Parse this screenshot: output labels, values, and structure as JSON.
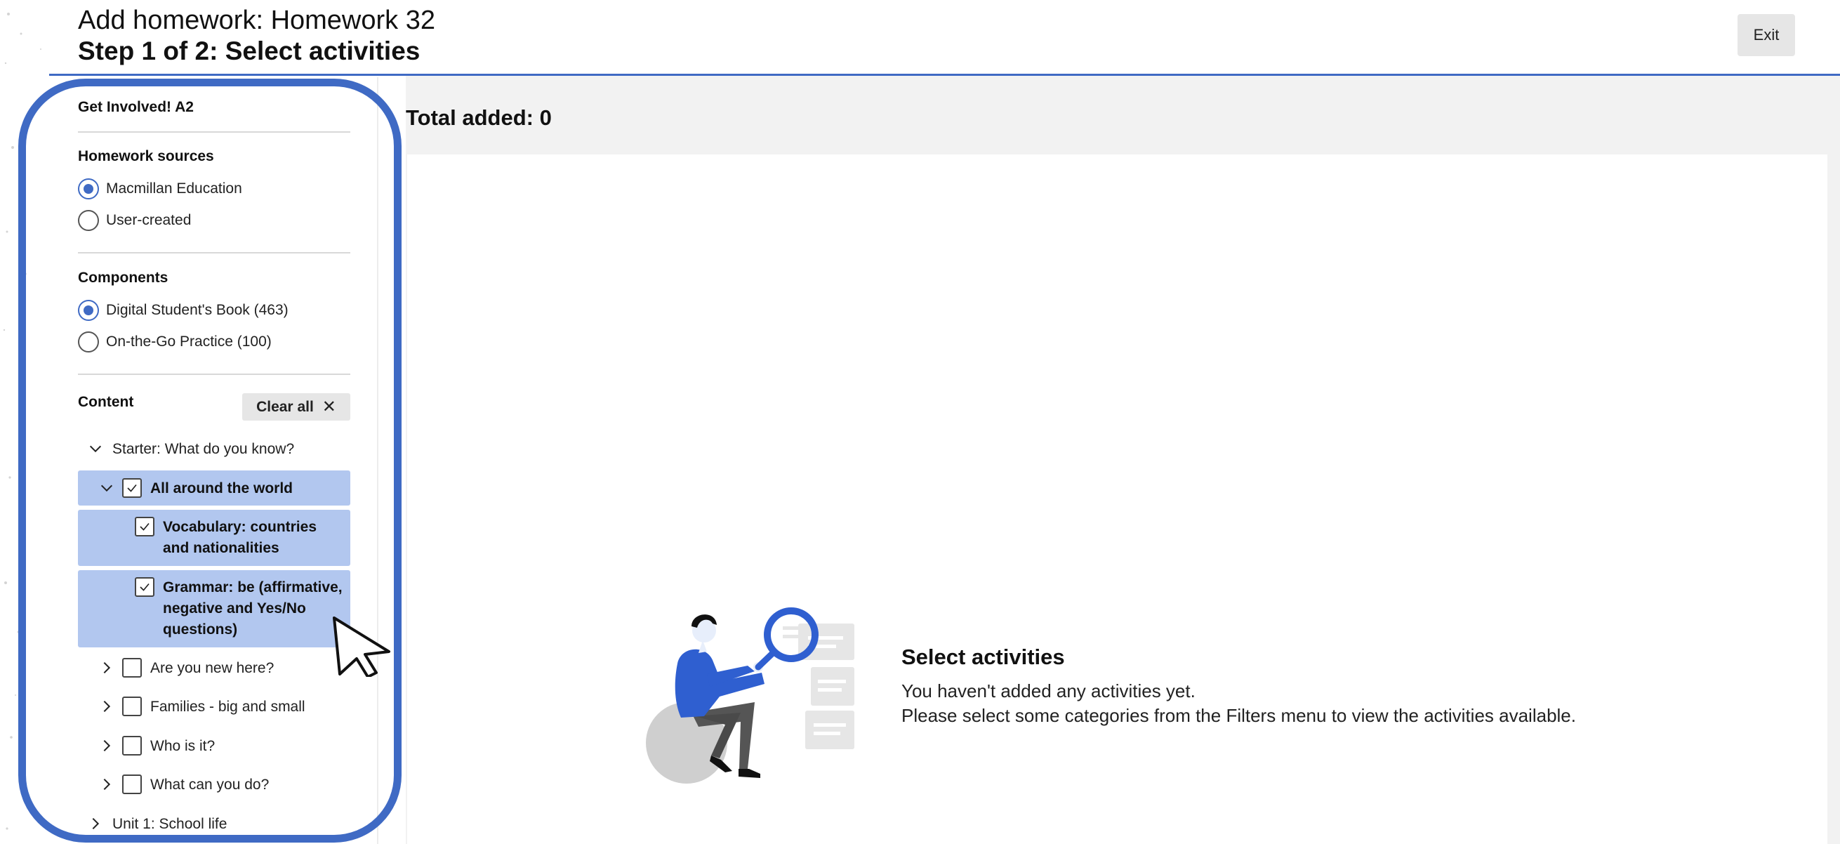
{
  "header": {
    "title": "Add homework: Homework 32",
    "step": "Step 1 of 2: Select activities",
    "exit_label": "Exit"
  },
  "sidebar": {
    "course": "Get Involved! A2",
    "homework_sources": {
      "heading": "Homework sources",
      "options": [
        {
          "label": "Macmillan Education",
          "selected": true
        },
        {
          "label": "User-created",
          "selected": false
        }
      ]
    },
    "components": {
      "heading": "Components",
      "options": [
        {
          "label": "Digital Student's Book (463)",
          "selected": true
        },
        {
          "label": "On-the-Go Practice (100)",
          "selected": false
        }
      ]
    },
    "content": {
      "heading": "Content",
      "clear_all_label": "Clear all",
      "tree": [
        {
          "label": "Starter: What do you know?",
          "expanded": true
        },
        {
          "label": "All around the world",
          "expanded": true,
          "checked": true
        },
        {
          "label": "Vocabulary: countries and nationalities",
          "checked": true
        },
        {
          "label": "Grammar: be (affirmative, negative and Yes/No questions)",
          "checked": true
        },
        {
          "label": "Are you new here?",
          "expanded": false,
          "checked": false
        },
        {
          "label": "Families - big and small",
          "expanded": false,
          "checked": false
        },
        {
          "label": "Who is it?",
          "expanded": false,
          "checked": false
        },
        {
          "label": "What can you do?",
          "expanded": false,
          "checked": false
        },
        {
          "label": "Unit 1: School life",
          "expanded": false
        }
      ]
    }
  },
  "main": {
    "total_added": "Total added: 0",
    "empty_state": {
      "title": "Select activities",
      "line1": "You haven't added any activities yet.",
      "line2": "Please select some categories from the Filters menu to view the activities available."
    }
  },
  "colors": {
    "accent": "#3f6ac4",
    "highlight": "#b2c7ef",
    "panel_gray": "#f2f2f2",
    "button_gray": "#e6e6e6"
  },
  "icons": [
    "close-icon",
    "chevron-down-icon",
    "chevron-right-icon",
    "checkmark-icon",
    "magnifier-illustration",
    "mouse-cursor-icon"
  ]
}
